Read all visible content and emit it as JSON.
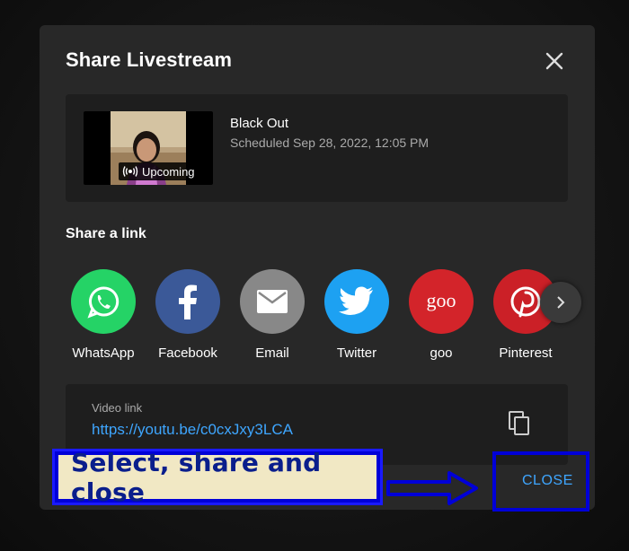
{
  "dialog": {
    "title": "Share Livestream",
    "close_icon": "close-icon"
  },
  "stream": {
    "title": "Black Out",
    "scheduled": "Scheduled Sep 28, 2022, 12:05 PM",
    "badge": "Upcoming",
    "badge_icon": "broadcast-icon"
  },
  "share": {
    "heading": "Share a link",
    "items": [
      {
        "label": "WhatsApp",
        "icon": "whatsapp-icon",
        "color": "#25D366"
      },
      {
        "label": "Facebook",
        "icon": "facebook-icon",
        "color": "#3b5998"
      },
      {
        "label": "Email",
        "icon": "email-icon",
        "color": "#888888"
      },
      {
        "label": "Twitter",
        "icon": "twitter-icon",
        "color": "#1da1f2"
      },
      {
        "label": "goo",
        "icon": "goo-icon",
        "color": "#d3242a"
      },
      {
        "label": "Pinterest",
        "icon": "pinterest-icon",
        "color": "#cb2027"
      }
    ],
    "next_icon": "chevron-right-icon"
  },
  "link": {
    "label": "Video link",
    "url": "https://youtu.be/c0cxJxy3LCA",
    "copy_icon": "copy-icon"
  },
  "annotation": {
    "callout": "Select, share and close",
    "arrow_icon": "arrow-right-icon"
  },
  "footer": {
    "close_label": "CLOSE"
  }
}
